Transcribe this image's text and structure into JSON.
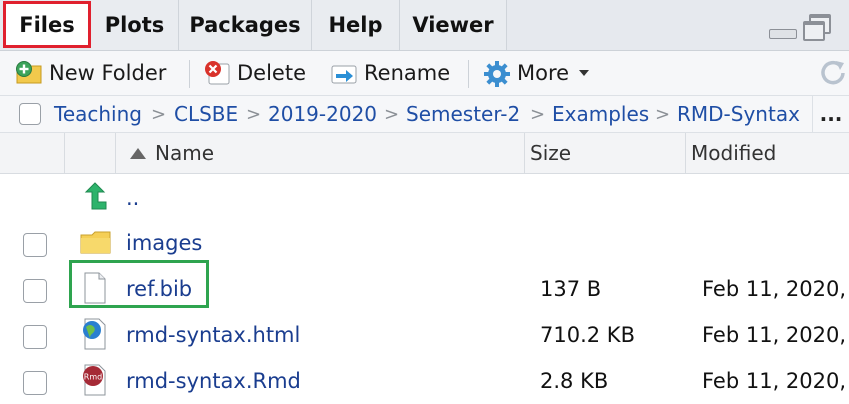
{
  "tabs": [
    {
      "label": "Files",
      "active": true
    },
    {
      "label": "Plots",
      "active": false
    },
    {
      "label": "Packages",
      "active": false
    },
    {
      "label": "Help",
      "active": false
    },
    {
      "label": "Viewer",
      "active": false
    }
  ],
  "toolbar": {
    "new_folder": "New Folder",
    "delete": "Delete",
    "rename": "Rename",
    "more": "More"
  },
  "breadcrumb": {
    "items": [
      "Teaching",
      "CLSBE",
      "2019-2020",
      "Semester-2",
      "Examples",
      "RMD-Syntax"
    ],
    "overflow": "..."
  },
  "table": {
    "columns": {
      "name": "Name",
      "size": "Size",
      "modified": "Modified"
    },
    "rows": [
      {
        "name": "..",
        "size": "",
        "modified": "",
        "icon": "parent-up-icon"
      },
      {
        "name": "images",
        "size": "",
        "modified": "",
        "icon": "folder-icon"
      },
      {
        "name": "ref.bib",
        "size": "137 B",
        "modified": "Feb 11, 2020,",
        "icon": "text-file-icon"
      },
      {
        "name": "rmd-syntax.html",
        "size": "710.2 KB",
        "modified": "Feb 11, 2020,",
        "icon": "html-file-icon"
      },
      {
        "name": "rmd-syntax.Rmd",
        "size": "2.8 KB",
        "modified": "Feb 11, 2020,",
        "icon": "rmd-file-icon"
      }
    ]
  },
  "colors": {
    "active_tab_outline": "#e0202e",
    "highlight_outline": "#2ea44f",
    "link": "#1a3d8f"
  }
}
